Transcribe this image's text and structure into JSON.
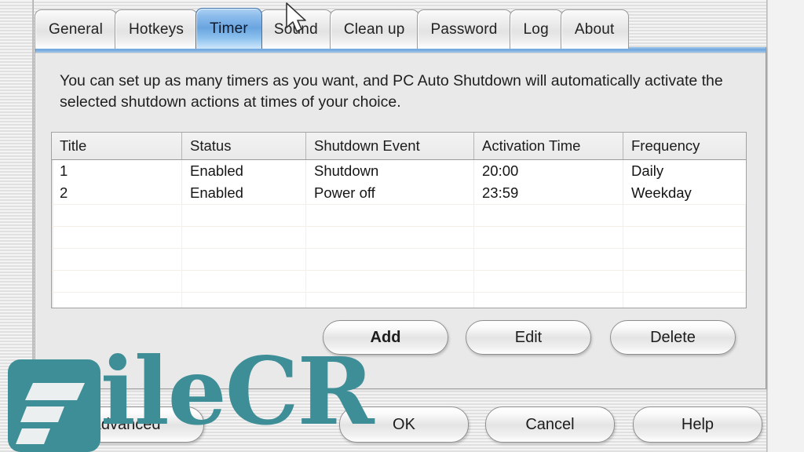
{
  "window": {
    "app_name": "PC Auto Shutdown"
  },
  "tabs": [
    {
      "label": "General",
      "active": false
    },
    {
      "label": "Hotkeys",
      "active": false
    },
    {
      "label": "Timer",
      "active": true
    },
    {
      "label": "Sound",
      "active": false
    },
    {
      "label": "Clean up",
      "active": false
    },
    {
      "label": "Password",
      "active": false
    },
    {
      "label": "Log",
      "active": false
    },
    {
      "label": "About",
      "active": false
    }
  ],
  "panel": {
    "description": "You can set up as many timers as you want, and PC Auto Shutdown will automatically activate the selected shutdown actions at times of your choice.",
    "list": {
      "columns": [
        "Title",
        "Status",
        "Shutdown Event",
        "Activation Time",
        "Frequency"
      ],
      "rows": [
        {
          "title": "1",
          "status": "Enabled",
          "event": "Shutdown",
          "time": "20:00",
          "frequency": "Daily"
        },
        {
          "title": "2",
          "status": "Enabled",
          "event": "Power off",
          "time": "23:59",
          "frequency": "Weekday"
        }
      ],
      "empty_row_count": 5
    },
    "buttons": {
      "add": "Add",
      "edit": "Edit",
      "delete": "Delete"
    }
  },
  "footer": {
    "advanced": "Advanced",
    "ok": "OK",
    "cancel": "Cancel",
    "help": "Help"
  },
  "watermark": {
    "text": "ileCR",
    "color": "#3d8e96"
  },
  "colors": {
    "active_tab_blue": "#6aa5e0",
    "panel_accent": "#6fa6dc",
    "panel_face": "#e9e9e9",
    "list_background": "#ffffff"
  }
}
